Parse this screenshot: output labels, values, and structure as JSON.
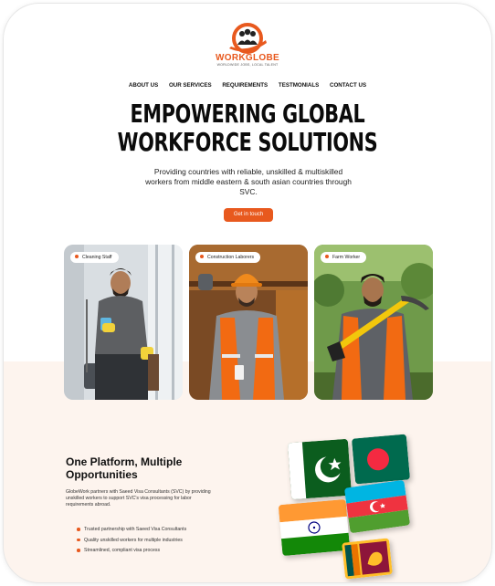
{
  "brand": {
    "name": "WORKGLOBE",
    "tagline": "WORLDWIDE JOBS, LOCAL TALENT",
    "accent": "#e8591e"
  },
  "nav": {
    "items": [
      "ABOUT US",
      "OUR SERVICES",
      "REQUIREMENTS",
      "TESTMONIALS",
      "CONTACT US"
    ]
  },
  "hero": {
    "title_line1": "EMPOWERING GLOBAL",
    "title_line2": "WORKFORCE SOLUTIONS",
    "subtitle": "Providing countries with reliable, unskilled & multiskilled workers from middle eastern & south asian countries through SVC.",
    "cta_label": "Get in touch"
  },
  "cards": [
    {
      "label": "Cleaning Staff"
    },
    {
      "label": "Construction Laborers"
    },
    {
      "label": "Farm Worker"
    }
  ],
  "platform": {
    "title": "One Platform, Multiple Opportunities",
    "body": "GlobeWork partners with Saeed Visa Consultants (SVC) by providing unskilled workers to support SVC's visa processing for labor requirements abroad.",
    "bullets": [
      "Trusted partnership with Saeed Visa Consultants",
      "Quality unskilled workers for multiple industries",
      "Streamlined, compliant visa process"
    ]
  },
  "flags": [
    "pakistan-flag",
    "bangladesh-flag",
    "india-flag",
    "azerbaijan-flag",
    "sri-lanka-flag"
  ]
}
